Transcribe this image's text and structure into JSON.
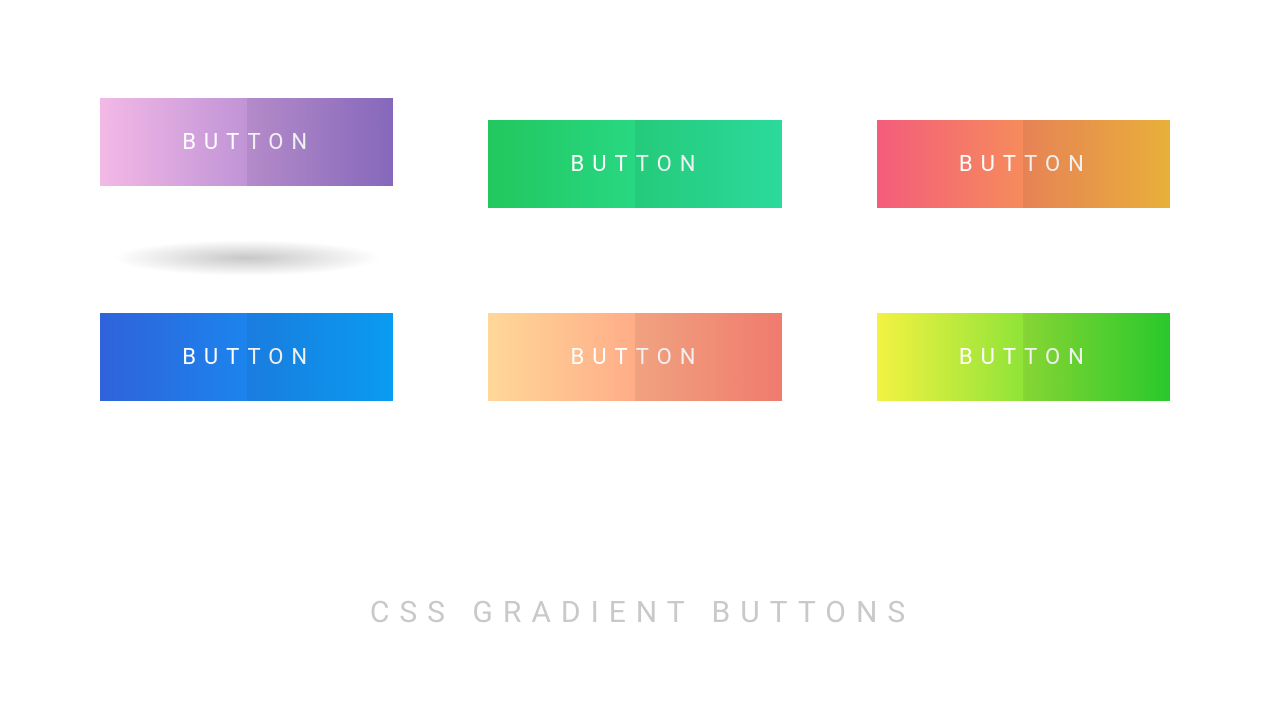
{
  "buttons": {
    "b1": {
      "label": "BUTTON"
    },
    "b2": {
      "label": "BUTTON"
    },
    "b3": {
      "label": "BUTTON"
    },
    "b4": {
      "label": "BUTTON"
    },
    "b5": {
      "label": "BUTTON"
    },
    "b6": {
      "label": "BUTTON"
    }
  },
  "title": "CSS GRADIENT BUTTONS",
  "colors": {
    "b1": [
      "#f3b9e6",
      "#8e6fc7"
    ],
    "b2": [
      "#22c75e",
      "#2ee8a6"
    ],
    "b3": [
      "#f45c7b",
      "#f7bb3d"
    ],
    "b4": [
      "#2f62db",
      "#0aa6ff"
    ],
    "b5": [
      "#ffd799",
      "#ff8376"
    ],
    "b6": [
      "#f3f242",
      "#2cd52e"
    ]
  }
}
